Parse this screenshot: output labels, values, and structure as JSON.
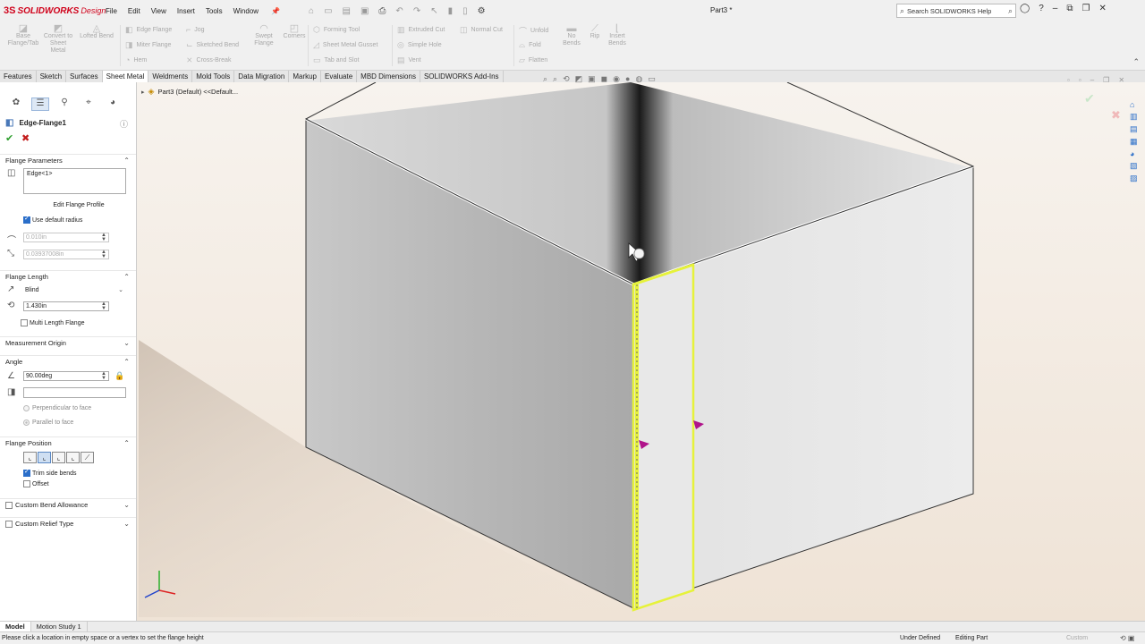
{
  "app": {
    "ds_logo": "3S",
    "brand": "SOLIDWORKS",
    "edition": "Design",
    "doc_title": "Part3 *"
  },
  "menu": [
    "File",
    "Edit",
    "View",
    "Insert",
    "Tools",
    "Window"
  ],
  "search": {
    "placeholder": "Search SOLIDWORKS Help"
  },
  "ribbon": {
    "big": [
      {
        "label": "Base Flange/Tab"
      },
      {
        "label": "Convert to Sheet Metal"
      },
      {
        "label": "Lofted Bend"
      },
      {
        "label": "Swept Flange"
      },
      {
        "label": "Corners"
      },
      {
        "label": "No Bends"
      },
      {
        "label": "Rip"
      },
      {
        "label": "Insert Bends"
      }
    ],
    "rows": [
      {
        "label": "Edge Flange"
      },
      {
        "label": "Miter Flange"
      },
      {
        "label": "Hem"
      },
      {
        "label": "Jog"
      },
      {
        "label": "Sketched Bend"
      },
      {
        "label": "Cross-Break"
      },
      {
        "label": "Forming Tool"
      },
      {
        "label": "Sheet Metal Gusset"
      },
      {
        "label": "Tab and Slot"
      },
      {
        "label": "Extruded Cut"
      },
      {
        "label": "Simple Hole"
      },
      {
        "label": "Vent"
      },
      {
        "label": "Normal Cut"
      },
      {
        "label": "Unfold"
      },
      {
        "label": "Fold"
      },
      {
        "label": "Flatten"
      }
    ]
  },
  "tabs": [
    "Features",
    "Sketch",
    "Surfaces",
    "Sheet Metal",
    "Weldments",
    "Mold Tools",
    "Data Migration",
    "Markup",
    "Evaluate",
    "MBD Dimensions",
    "SOLIDWORKS Add-Ins"
  ],
  "active_tab": "Sheet Metal",
  "pm": {
    "title": "Edge-Flange1",
    "flange_params": {
      "header": "Flange Parameters",
      "edge_selection": "Edge<1>",
      "edit_profile": "Edit Flange Profile",
      "use_default_radius": "Use default radius",
      "use_default_radius_checked": true,
      "radius": "0.010in",
      "gap": "0.03937008in"
    },
    "flange_length": {
      "header": "Flange Length",
      "end_condition": "Blind",
      "length": "1.430in",
      "multi_length": "Multi Length Flange",
      "multi_length_checked": false
    },
    "measurement_origin": {
      "header": "Measurement Origin"
    },
    "angle": {
      "header": "Angle",
      "value": "90.00deg",
      "perpendicular": "Perpendicular to face",
      "parallel": "Parallel to face",
      "selected": "Parallel to face"
    },
    "flange_position": {
      "header": "Flange Position",
      "trim_side_bends": "Trim side bends",
      "trim_checked": true,
      "offset": "Offset",
      "offset_checked": false
    },
    "custom_bend_allowance": "Custom Bend Allowance",
    "custom_relief_type": "Custom Relief Type"
  },
  "tree": {
    "label": "Part3 (Default) <<Default..."
  },
  "model_tabs": [
    "Model",
    "Motion Study 1"
  ],
  "active_model_tab": "Model",
  "status": {
    "message": "Please click a location in empty space or a vertex to set the flange height",
    "state": "Under Defined",
    "mode": "Editing Part",
    "units": "Custom"
  },
  "colors": {
    "accent": "#2a6ec9",
    "brand": "#d0021b",
    "selection": "#e6f23a",
    "handle": "#b0148a"
  }
}
